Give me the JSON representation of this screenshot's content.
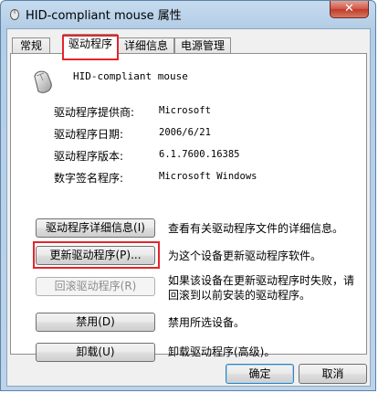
{
  "window": {
    "title": "HID-compliant mouse 属性",
    "close_glyph": "✕"
  },
  "tabs": [
    {
      "label": "常规"
    },
    {
      "label": "驱动程序",
      "active": true
    },
    {
      "label": "详细信息"
    },
    {
      "label": "电源管理"
    }
  ],
  "device": {
    "icon": "mouse-icon",
    "name": "HID-compliant mouse"
  },
  "properties": [
    {
      "label": "驱动程序提供商:",
      "value": "Microsoft"
    },
    {
      "label": "驱动程序日期:",
      "value": "2006/6/21"
    },
    {
      "label": "驱动程序版本:",
      "value": "6.1.7600.16385"
    },
    {
      "label": "数字签名程序:",
      "value": "Microsoft Windows"
    }
  ],
  "actions": [
    {
      "button": "驱动程序详细信息(I)",
      "description": "查看有关驱动程序文件的详细信息。",
      "enabled": true
    },
    {
      "button": "更新驱动程序(P)...",
      "description": "为这个设备更新驱动程序软件。",
      "enabled": true
    },
    {
      "button": "回滚驱动程序(R)",
      "description_line1": "如果该设备在更新驱动程序时失败，请",
      "description_line2": "回滚到以前安装的驱动程序。",
      "enabled": false
    },
    {
      "button": "禁用(D)",
      "description": "禁用所选设备。",
      "enabled": true
    },
    {
      "button": "卸载(U)",
      "description": "卸载驱动程序(高级)。",
      "enabled": true
    }
  ],
  "footer": {
    "ok_label": "确定",
    "cancel_label": "取消"
  },
  "colors": {
    "highlight": "#e3252b"
  }
}
